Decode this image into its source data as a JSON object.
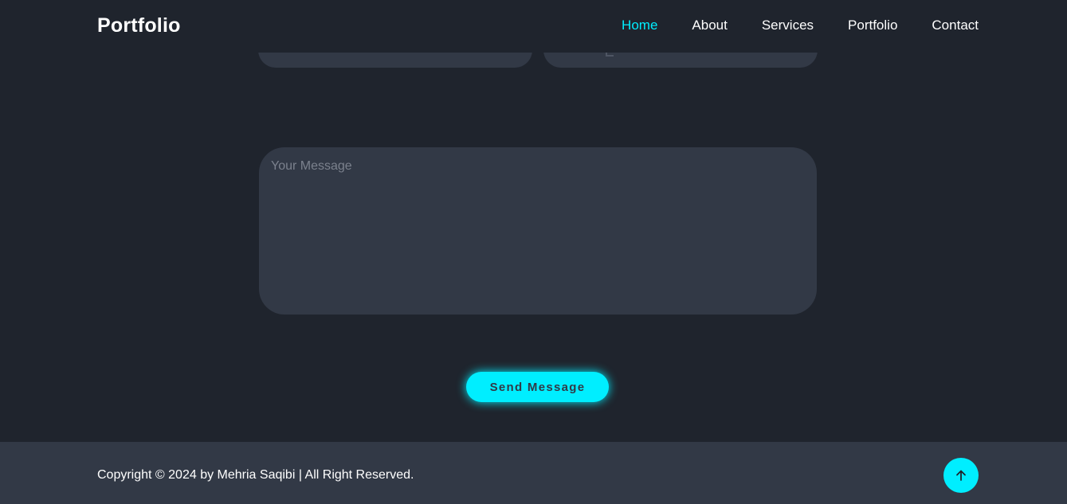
{
  "header": {
    "logo": "Portfolio",
    "nav": [
      {
        "label": "Home",
        "active": true
      },
      {
        "label": "About",
        "active": false
      },
      {
        "label": "Services",
        "active": false
      },
      {
        "label": "Portfolio",
        "active": false
      },
      {
        "label": "Contact",
        "active": false
      }
    ]
  },
  "contact_form": {
    "message_placeholder": "Your Message",
    "send_label": "Send Message"
  },
  "footer": {
    "copyright": "Copyright © 2024 by Mehria Saqibi | All Right Reserved.",
    "top_button_icon": "arrow-up-icon"
  },
  "colors": {
    "background": "#1f242d",
    "surface": "#323946",
    "accent": "#00eeff",
    "text": "#ffffff"
  }
}
